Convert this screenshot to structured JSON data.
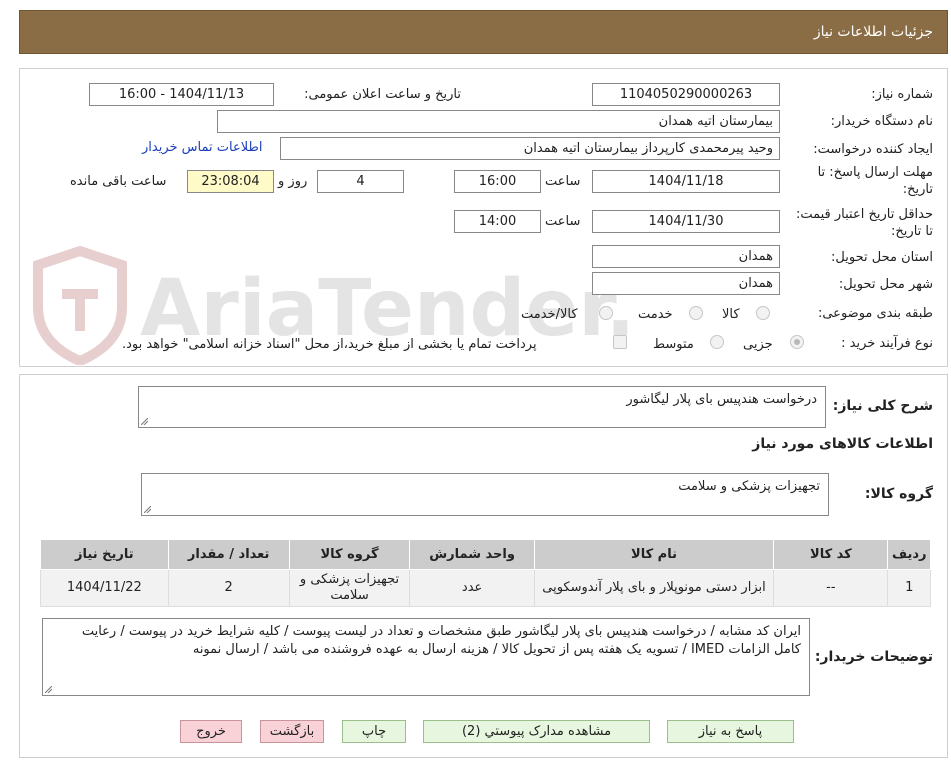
{
  "header": {
    "title": "جزئیات اطلاعات نیاز"
  },
  "form": {
    "need_number_label": "شماره نیاز:",
    "need_number": "1104050290000263",
    "announce_label": "تاریخ و ساعت اعلان عمومی:",
    "announce_value": "1404/11/13 - 16:00",
    "buyer_label": "نام دستگاه خریدار:",
    "buyer": "بیمارستان اتیه همدان",
    "creator_label": "ایجاد کننده درخواست:",
    "creator": "وحید پیرمحمدی کارپرداز بیمارستان اتیه همدان",
    "contact_link": "اطلاعات تماس خریدار",
    "deadline_label": "مهلت ارسال پاسخ: تا تاریخ:",
    "deadline_date": "1404/11/18",
    "time_label": "ساعت",
    "deadline_time": "16:00",
    "days_value": "4",
    "days_label": "روز و",
    "remaining_time": "23:08:04",
    "remaining_label": "ساعت باقی مانده",
    "validity_label": "حداقل تاریخ اعتبار قیمت: تا تاریخ:",
    "validity_date": "1404/11/30",
    "validity_time_label": "ساعت",
    "validity_time": "14:00",
    "province_label": "استان محل تحویل:",
    "province": "همدان",
    "city_label": "شهر محل تحویل:",
    "city": "همدان",
    "category_label": "طبقه بندی موضوعی:",
    "category_options": [
      "کالا",
      "خدمت",
      "کالا/خدمت"
    ],
    "process_label": "نوع فرآیند خرید :",
    "process_options": [
      "جزیی",
      "متوسط"
    ],
    "payment_note": "پرداخت تمام یا بخشی از مبلغ خرید،از محل \"اسناد خزانه اسلامی\" خواهد بود."
  },
  "details": {
    "summary_label": "شرح کلی نیاز:",
    "summary": "درخواست هندپیس بای پلار لیگاشور",
    "goods_info_heading": "اطلاعات کالاهای مورد نیاز",
    "goods_group_label": "گروه کالا:",
    "goods_group": "تجهیزات پزشکی و سلامت",
    "table": {
      "headers": [
        "ردیف",
        "کد کالا",
        "نام کالا",
        "واحد شمارش",
        "گروه کالا",
        "تعداد / مقدار",
        "تاریخ نیاز"
      ],
      "rows": [
        [
          "1",
          "--",
          "ابزار دستی مونوپلار و بای پلار آندوسکوپی",
          "عدد",
          "تجهیزات پزشکی و سلامت",
          "2",
          "1404/11/22"
        ]
      ]
    },
    "notes_label": "توضیحات خریدار:",
    "notes": "ایران کد مشابه / درخواست هندپیس بای پلار لیگاشور طبق مشخصات و تعداد در لیست پیوست / کلیه شرایط خرید در پیوست / رعایت کامل الزامات IMED / تسویه یک هفته پس از تحویل کالا  / هزینه ارسال به عهده فروشنده می باشد / ارسال نمونه"
  },
  "buttons": {
    "reply": "پاسخ به نیاز",
    "attachments": "مشاهده مدارک پیوستي (2)",
    "print": "چاپ",
    "back": "بازگشت",
    "exit": "خروج"
  },
  "watermark": {
    "text": "AriaTender.neT"
  },
  "colors": {
    "header_bg": "#8a6d44",
    "link": "#1a3fb8",
    "timer_bg": "#fffbc9",
    "green_btn": "#e7f7df",
    "pink_btn": "#f9d2d7"
  }
}
